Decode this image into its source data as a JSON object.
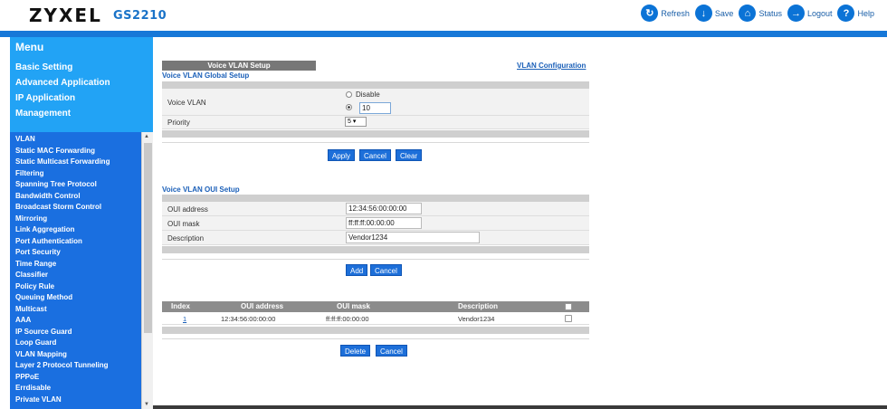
{
  "header": {
    "brand": "ZYXEL",
    "model": "GS2210",
    "buttons": [
      {
        "label": "Refresh",
        "icon": "refresh-icon"
      },
      {
        "label": "Save",
        "icon": "save-icon"
      },
      {
        "label": "Status",
        "icon": "status-icon"
      },
      {
        "label": "Logout",
        "icon": "logout-icon"
      },
      {
        "label": "Help",
        "icon": "help-icon"
      }
    ]
  },
  "menu": {
    "title": "Menu",
    "categories": [
      "Basic Setting",
      "Advanced Application",
      "IP Application",
      "Management"
    ],
    "items": [
      "VLAN",
      "Static MAC Forwarding",
      "Static Multicast Forwarding",
      "Filtering",
      "Spanning Tree Protocol",
      "Bandwidth Control",
      "Broadcast Storm Control",
      "Mirroring",
      "Link Aggregation",
      "Port Authentication",
      "Port Security",
      "Time Range",
      "Classifier",
      "Policy Rule",
      "Queuing Method",
      "Multicast",
      "AAA",
      "IP Source Guard",
      "Loop Guard",
      "VLAN Mapping",
      "Layer 2 Protocol Tunneling",
      "PPPoE",
      "Errdisable",
      "Private VLAN"
    ]
  },
  "voice_vlan_setup": {
    "header": "Voice VLAN Setup",
    "config_link": "VLAN Configuration",
    "global_title": "Voice VLAN Global Setup",
    "voice_vlan_label": "Voice VLAN",
    "disable_label": "Disable",
    "vlan_value": "10",
    "priority_label": "Priority",
    "priority_value": "5",
    "apply": "Apply",
    "cancel": "Cancel",
    "clear": "Clear"
  },
  "oui_setup": {
    "title": "Voice VLAN OUI Setup",
    "oui_address_label": "OUI address",
    "oui_address_value": "12:34:56:00:00:00",
    "oui_mask_label": "OUI mask",
    "oui_mask_value": "ff:ff:ff:00:00:00",
    "description_label": "Description",
    "description_value": "Vendor1234",
    "add": "Add",
    "cancel": "Cancel"
  },
  "oui_table": {
    "columns": [
      "Index",
      "OUI address",
      "OUI mask",
      "Description"
    ],
    "rows": [
      {
        "index": "1",
        "oui_address": "12:34:56:00:00:00",
        "oui_mask": "ff:ff:ff:00:00:00",
        "description": "Vendor1234"
      }
    ],
    "delete": "Delete",
    "cancel": "Cancel"
  }
}
